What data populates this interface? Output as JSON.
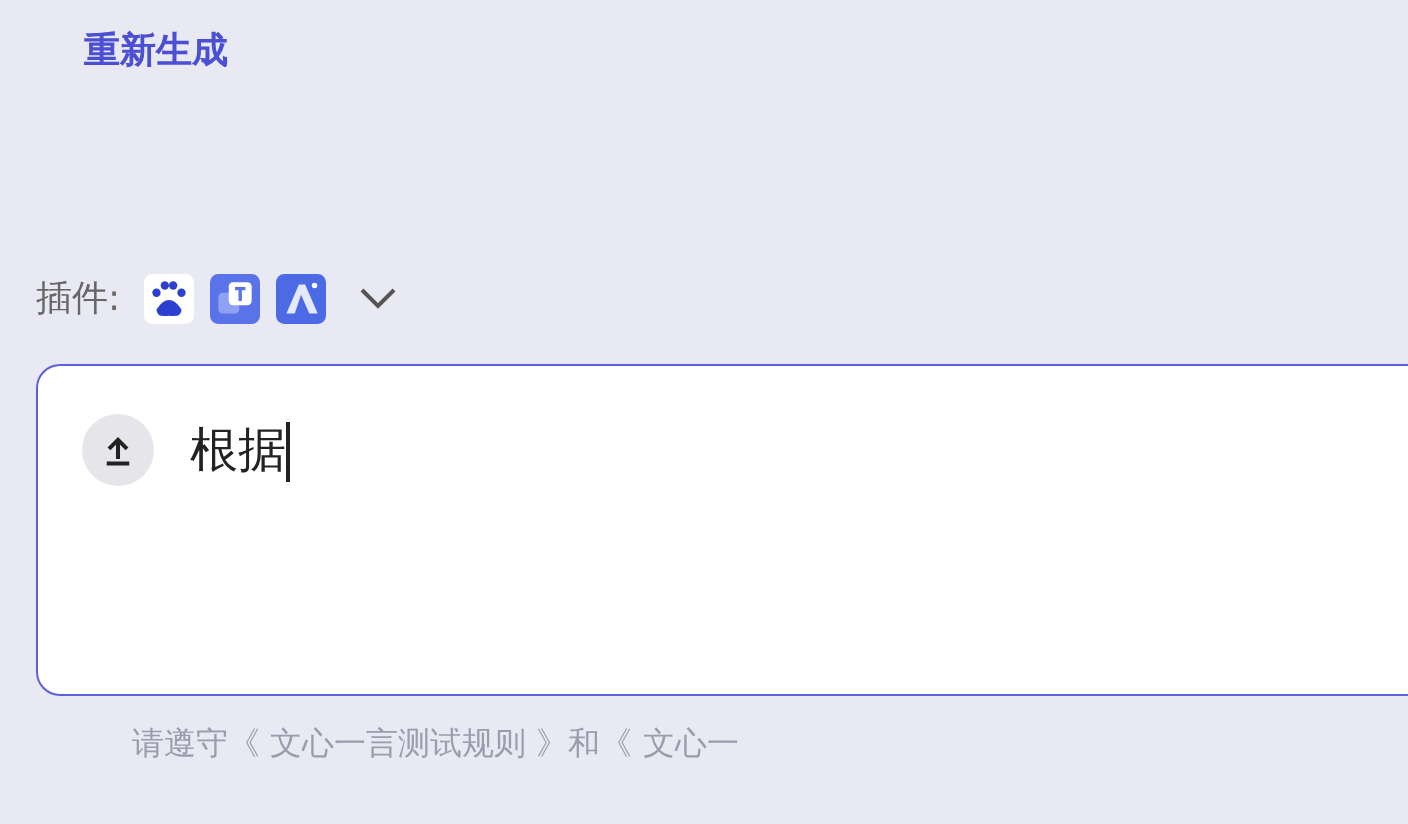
{
  "regenerate_link": "重新生成",
  "plugins": {
    "label": "插件:",
    "items": [
      {
        "kind": "paw"
      },
      {
        "kind": "translate"
      },
      {
        "kind": "letter"
      }
    ],
    "expanded": false
  },
  "input": {
    "value": "根据"
  },
  "footer": "请遵守《 文心一言测试规则 》和《 文心一"
}
